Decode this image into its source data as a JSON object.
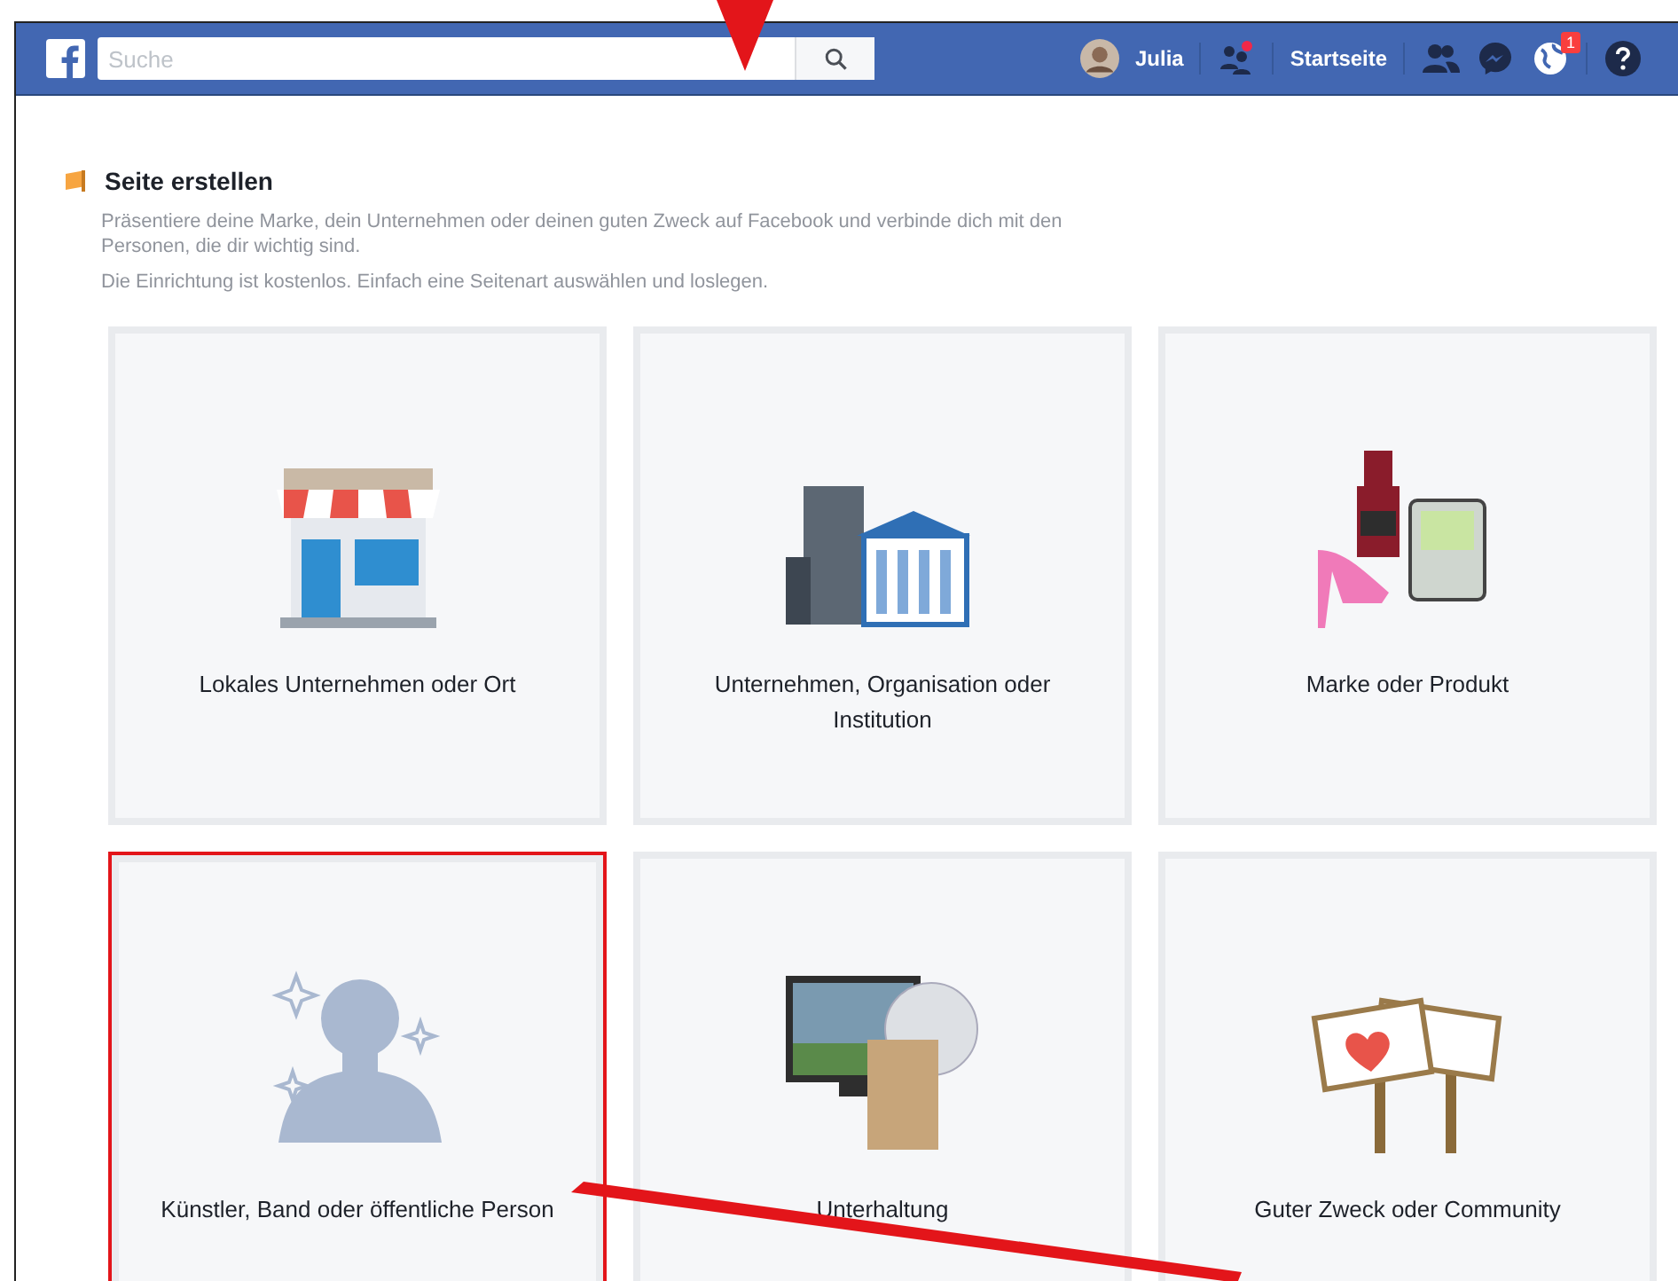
{
  "header": {
    "search": {
      "placeholder": "Suche"
    },
    "profile_name": "Julia",
    "home_link": "Startseite",
    "notification_count": "1"
  },
  "page": {
    "title": "Seite erstellen",
    "description": "Präsentiere deine Marke, dein Unternehmen oder deinen guten Zweck auf Facebook und verbinde dich mit den Personen, die dir wichtig sind.",
    "note": "Die Einrichtung ist kostenlos. Einfach eine Seitenart auswählen und loslegen."
  },
  "categories": [
    {
      "kind": "store",
      "label": "Lokales Unternehmen oder Ort",
      "highlighted": false
    },
    {
      "kind": "buildings",
      "label": "Unternehmen, Organisation oder Institution",
      "highlighted": false
    },
    {
      "kind": "products",
      "label": "Marke oder Produkt",
      "highlighted": false
    },
    {
      "kind": "person",
      "label": "Künstler, Band oder öffentliche Person",
      "highlighted": true
    },
    {
      "kind": "media",
      "label": "Unterhaltung",
      "highlighted": false
    },
    {
      "kind": "signs",
      "label": "Guter Zweck oder Community",
      "highlighted": false
    }
  ]
}
